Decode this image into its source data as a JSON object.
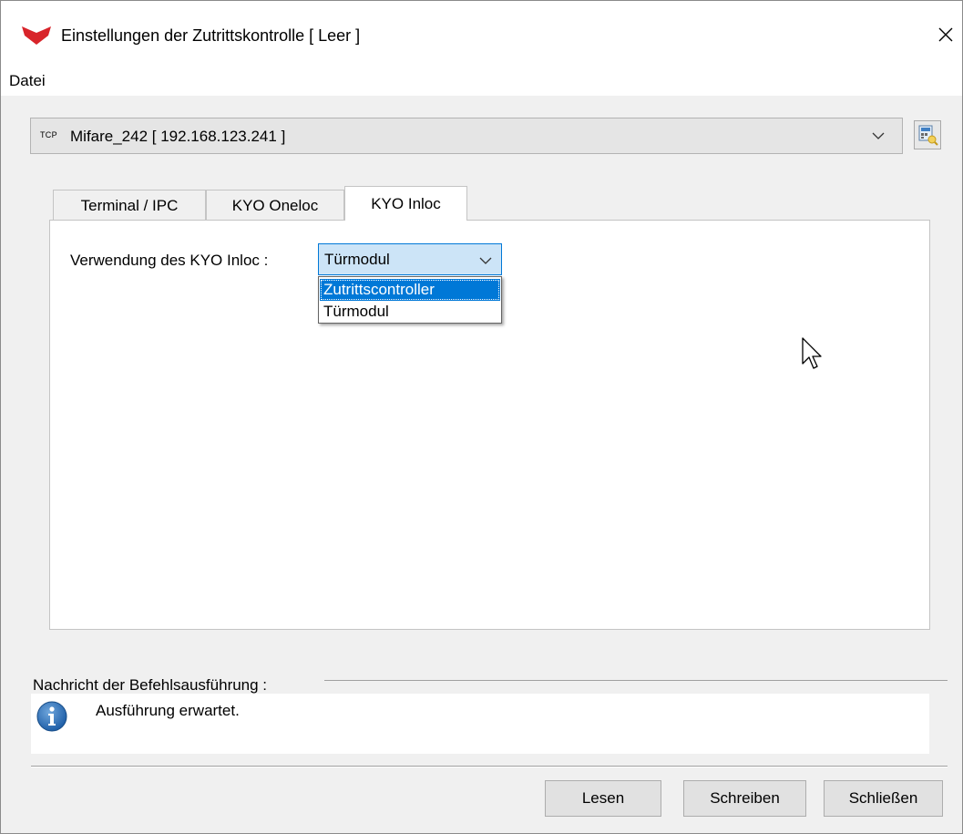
{
  "window": {
    "title": "Einstellungen der Zutrittskontrolle [ Leer ]",
    "close_glyph": "×",
    "logo_icon": "red-fox-logo-icon",
    "accent_color": "#0078d7"
  },
  "menu": {
    "file_label": "Datei"
  },
  "device": {
    "protocol_badge": "TCP",
    "selected": "Mifare_242 [ 192.168.123.241 ]",
    "tool_icon": "terminal-search-icon"
  },
  "tabs": [
    {
      "label": "Terminal / IPC",
      "active": false
    },
    {
      "label": "KYO Oneloc",
      "active": false
    },
    {
      "label": "KYO Inloc",
      "active": true
    }
  ],
  "inloc": {
    "usage_label": "Verwendung des KYO Inloc :",
    "usage_value": "Türmodul",
    "options": [
      "Zutrittscontroller",
      "Türmodul"
    ],
    "highlighted_option": "Zutrittscontroller"
  },
  "message": {
    "header": "Nachricht der Befehlsausführung :",
    "text": "Ausführung erwartet.",
    "icon": "info-icon"
  },
  "buttons": {
    "read": "Lesen",
    "write": "Schreiben",
    "close": "Schließen"
  }
}
